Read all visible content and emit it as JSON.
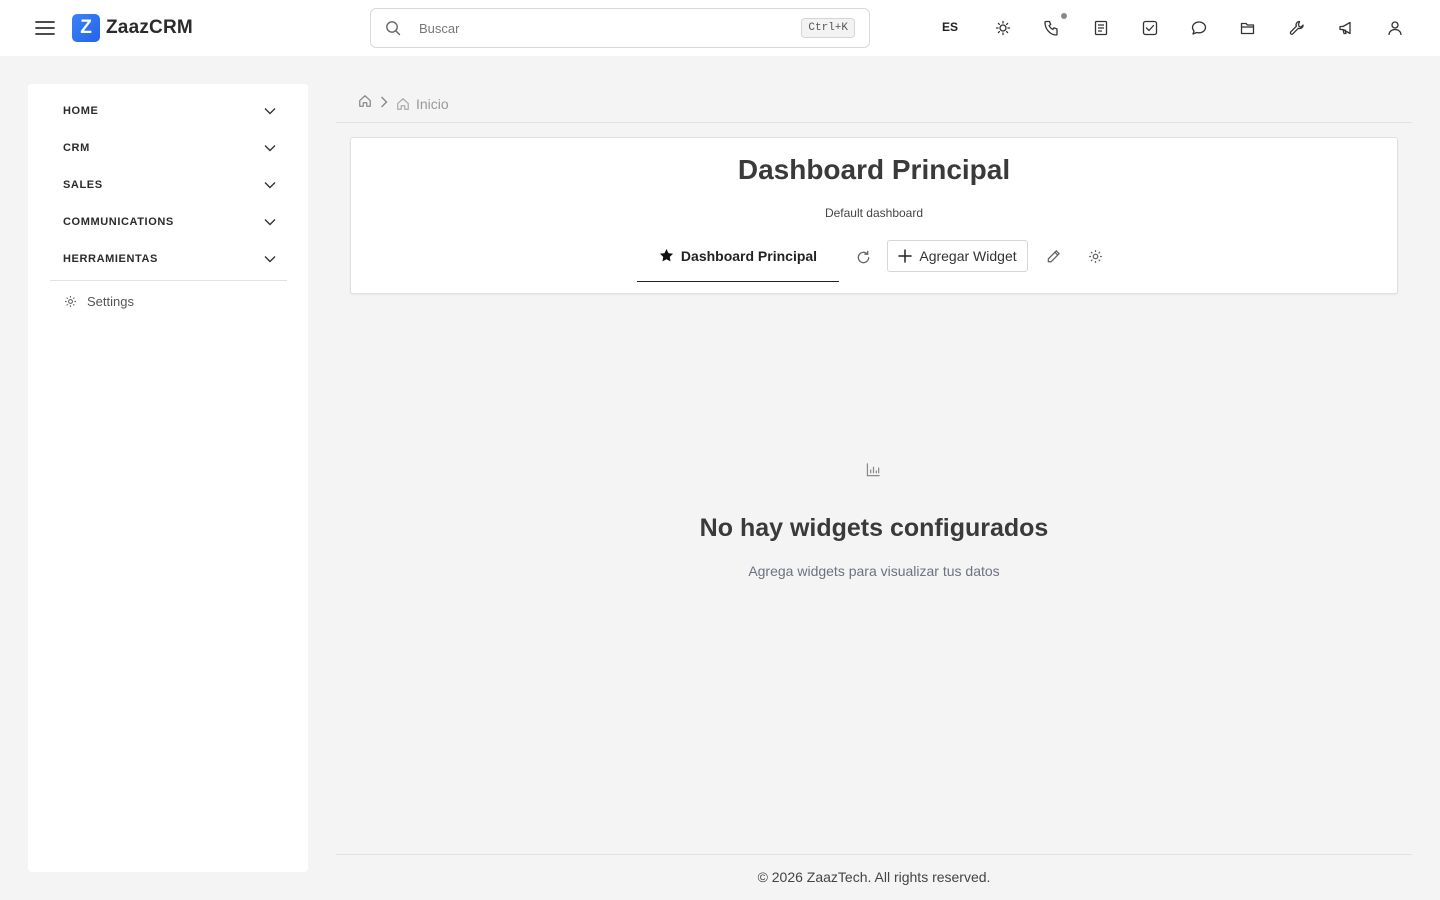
{
  "header": {
    "brand_letter": "Z",
    "brand_name": "ZaazCRM",
    "search_placeholder": "Buscar",
    "search_shortcut": "Ctrl+K",
    "language": "ES",
    "icons": [
      "sun-icon",
      "phone-icon",
      "notes-icon",
      "tasks-icon",
      "chat-icon",
      "folder-icon",
      "wrench-icon",
      "megaphone-icon",
      "user-icon"
    ]
  },
  "sidebar": {
    "items": [
      {
        "label": "HOME"
      },
      {
        "label": "CRM"
      },
      {
        "label": "SALES"
      },
      {
        "label": "COMMUNICATIONS"
      },
      {
        "label": "HERRAMIENTAS"
      }
    ],
    "settings_label": "Settings"
  },
  "breadcrumb": {
    "current": "Inicio"
  },
  "dashboard": {
    "title": "Dashboard Principal",
    "subtitle": "Default dashboard",
    "tab_label": "Dashboard Principal",
    "add_widget_label": "Agregar Widget"
  },
  "empty_state": {
    "title": "No hay widgets configurados",
    "subtitle": "Agrega widgets para visualizar tus datos"
  },
  "footer": {
    "text": "© 2026 ZaazTech. All rights reserved."
  },
  "colors": {
    "brand": "#2563eb",
    "background": "#f4f4f4",
    "notification_dot": "#8a8a8a"
  }
}
